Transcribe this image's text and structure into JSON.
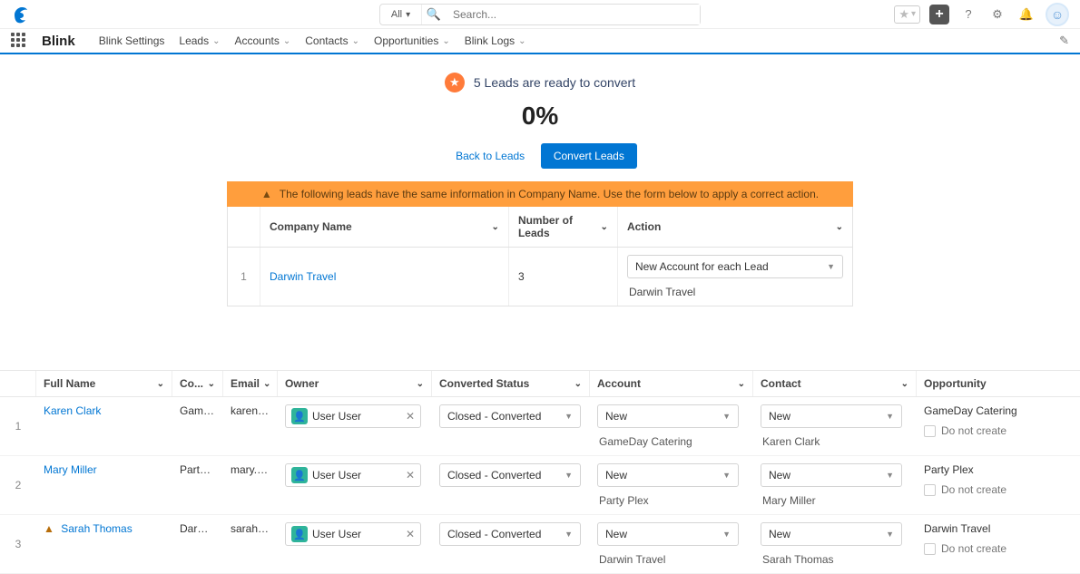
{
  "global": {
    "search_scope": "All",
    "search_placeholder": "Search..."
  },
  "nav": {
    "app_name": "Blink",
    "items": [
      "Blink Settings",
      "Leads",
      "Accounts",
      "Contacts",
      "Opportunities",
      "Blink Logs"
    ]
  },
  "banner": {
    "text": "5 Leads are ready to convert",
    "percent": "0%",
    "back_label": "Back to Leads",
    "convert_label": "Convert Leads"
  },
  "warning": "The following leads have the same information in Company Name. Use the form below to apply a correct action.",
  "dup_table": {
    "headers": {
      "company": "Company Name",
      "num": "Number of Leads",
      "action": "Action"
    },
    "rows": [
      {
        "n": "1",
        "company": "Darwin Travel",
        "num": "3",
        "action": "New Account for each Lead",
        "action_sub": "Darwin Travel"
      }
    ]
  },
  "leads_headers": {
    "name": "Full Name",
    "co": "Co...",
    "email": "Email",
    "owner": "Owner",
    "status": "Converted Status",
    "account": "Account",
    "contact": "Contact",
    "opp": "Opportunity"
  },
  "owner_chip": "User User",
  "status_value": "Closed - Converted",
  "new_value": "New",
  "dnc_label": "Do not create",
  "leads": [
    {
      "n": "1",
      "warn": false,
      "name": "Karen Clark",
      "co": "GameDa...",
      "email": "karen.cl...",
      "account_sub": "GameDay Catering",
      "contact_sub": "Karen Clark",
      "opp": "GameDay Catering"
    },
    {
      "n": "2",
      "warn": false,
      "name": "Mary Miller",
      "co": "Party Plex",
      "email": "mary.mil...",
      "account_sub": "Party Plex",
      "contact_sub": "Mary Miller",
      "opp": "Party Plex"
    },
    {
      "n": "3",
      "warn": true,
      "name": "Sarah Thomas",
      "co": "Darwin T...",
      "email": "sarah.th...",
      "account_sub": "Darwin Travel",
      "contact_sub": "Sarah Thomas",
      "opp": "Darwin Travel"
    }
  ]
}
